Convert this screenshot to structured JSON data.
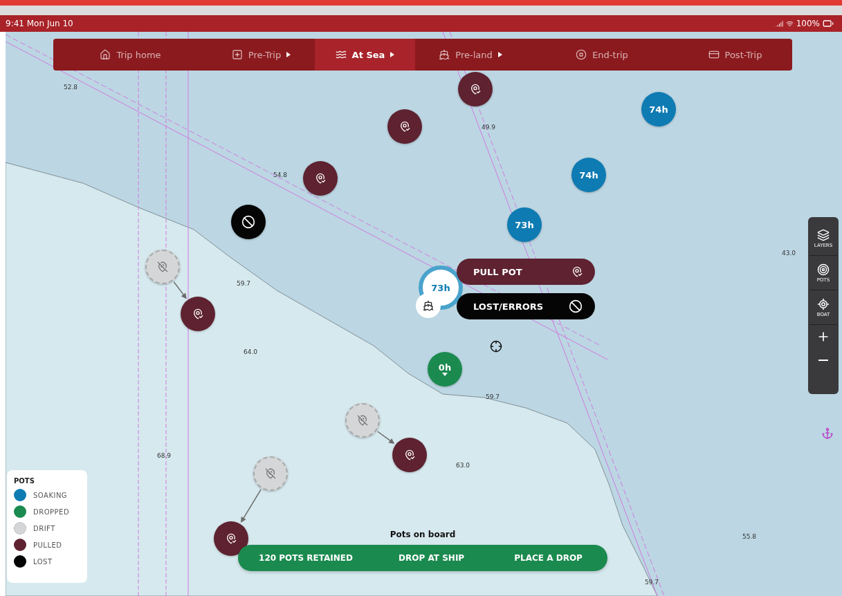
{
  "status_bar": {
    "time": "9:41 Mon Jun 10",
    "battery": "100%"
  },
  "trip_nav": [
    {
      "kind": "home",
      "label": "Trip home",
      "selected": false,
      "caret": false
    },
    {
      "kind": "pretrip",
      "label": "Pre-Trip",
      "selected": false,
      "caret": true
    },
    {
      "kind": "sea",
      "label": "At Sea",
      "selected": true,
      "caret": true
    },
    {
      "kind": "preland",
      "label": "Pre-land",
      "selected": false,
      "caret": true
    },
    {
      "kind": "end",
      "label": "End-trip",
      "selected": false,
      "caret": false
    },
    {
      "kind": "post",
      "label": "Post-Trip",
      "selected": false,
      "caret": false
    }
  ],
  "map": {
    "soundings": [
      "52.8",
      "49.9",
      "54.8",
      "59.7",
      "64.0",
      "59.7",
      "68.9",
      "63.0",
      "43.0",
      "55.8",
      "59.7"
    ],
    "markers": [
      {
        "kind": "pulled"
      },
      {
        "kind": "pulled"
      },
      {
        "kind": "pulled"
      },
      {
        "kind": "lost"
      },
      {
        "kind": "drift"
      },
      {
        "kind": "pulled"
      },
      {
        "kind": "drift"
      },
      {
        "kind": "pulled"
      },
      {
        "kind": "drift"
      },
      {
        "kind": "pulled"
      },
      {
        "kind": "soaking",
        "label": "74h"
      },
      {
        "kind": "soaking",
        "label": "74h"
      },
      {
        "kind": "soaking",
        "label": "73h"
      },
      {
        "kind": "dropped",
        "label": "0h"
      }
    ],
    "selected_pot": {
      "label": "73h"
    },
    "actions": [
      {
        "kind": "pulled",
        "label": "PULL POT"
      },
      {
        "kind": "lost",
        "label": "LOST/ERRORS"
      }
    ]
  },
  "map_tools": [
    {
      "kind": "layers",
      "label": "LAYERS"
    },
    {
      "kind": "pots",
      "label": "POTS"
    },
    {
      "kind": "boat",
      "label": "BOAT"
    },
    {
      "kind": "zoom_in"
    },
    {
      "kind": "zoom_out"
    }
  ],
  "legend": {
    "title": "POTS",
    "items": [
      {
        "kind": "soaking",
        "label": "SOAKING"
      },
      {
        "kind": "dropped",
        "label": "DROPPED"
      },
      {
        "kind": "drift",
        "label": "DRIFT"
      },
      {
        "kind": "pulled",
        "label": "PULLED"
      },
      {
        "kind": "lost",
        "label": "LOST"
      }
    ]
  },
  "pots_on_board": {
    "title": "Pots on board",
    "retained": "120 POTS RETAINED",
    "buttons": [
      "DROP AT SHIP",
      "PLACE A DROP"
    ]
  }
}
